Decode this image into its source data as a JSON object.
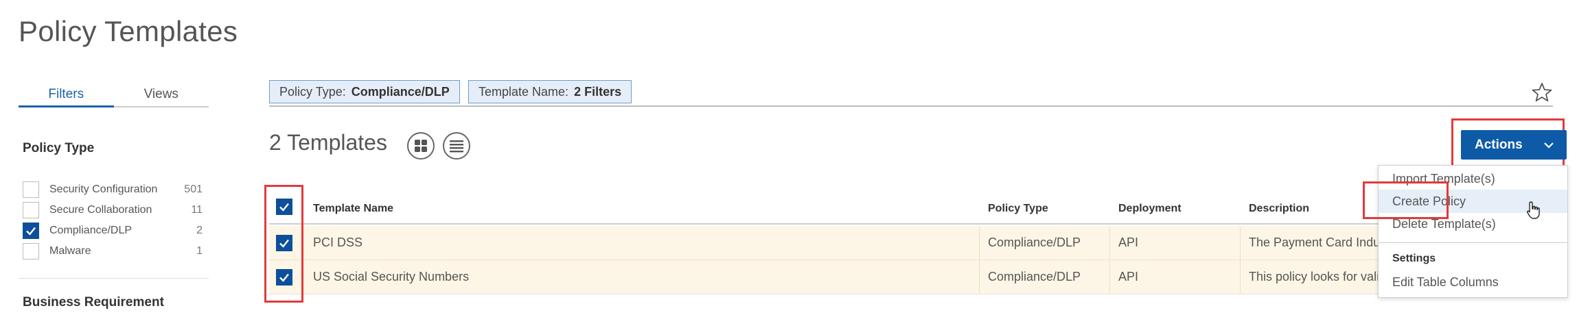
{
  "page": {
    "title": "Policy Templates"
  },
  "sidebar": {
    "tabs": [
      {
        "label": "Filters",
        "active": true
      },
      {
        "label": "Views",
        "active": false
      }
    ],
    "policy_type_heading": "Policy Type",
    "policy_types": [
      {
        "label": "Security Configuration",
        "count": "501",
        "checked": false
      },
      {
        "label": "Secure Collaboration",
        "count": "11",
        "checked": false
      },
      {
        "label": "Compliance/DLP",
        "count": "2",
        "checked": true
      },
      {
        "label": "Malware",
        "count": "1",
        "checked": false
      }
    ],
    "business_requirement_heading": "Business Requirement"
  },
  "filter_bar": {
    "chips": [
      {
        "key": "Policy Type:",
        "value": "Compliance/DLP"
      },
      {
        "key": "Template Name:",
        "value": "2 Filters"
      }
    ]
  },
  "results": {
    "count_label": "2 Templates"
  },
  "actions": {
    "button_label": "Actions",
    "menu": {
      "import": "Import Template(s)",
      "create": "Create Policy",
      "delete": "Delete Template(s)",
      "settings_heading": "Settings",
      "edit_columns": "Edit Table Columns"
    }
  },
  "table": {
    "columns": [
      "Template Name",
      "Policy Type",
      "Deployment",
      "Description"
    ],
    "rows": [
      {
        "name": "PCI DSS",
        "policy_type": "Compliance/DLP",
        "deployment": "API",
        "description": "The Payment Card Industry Data Security Standard"
      },
      {
        "name": "US Social Security Numbers",
        "policy_type": "Compliance/DLP",
        "deployment": "API",
        "description": "This policy looks for valid US Social Security Numbers"
      }
    ]
  },
  "colors": {
    "accent": "#0d5aa7",
    "highlight_outline": "#e23a3a",
    "row_background": "#fdf6e6"
  }
}
